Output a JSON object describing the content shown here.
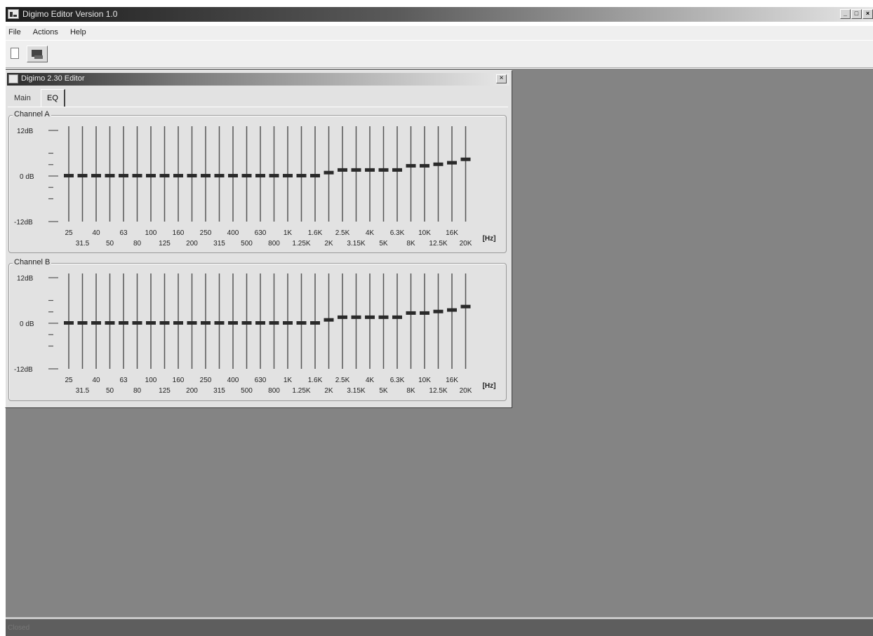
{
  "app": {
    "title": "Digimo Editor  Version 1.0",
    "window_buttons": [
      "_",
      "□",
      "×"
    ]
  },
  "menu": [
    {
      "label": "File"
    },
    {
      "label": "Actions"
    },
    {
      "label": "Help"
    }
  ],
  "toolbar": {
    "buttons": [
      {
        "icon": "new-document-icon"
      },
      {
        "icon": "connect-device-icon"
      }
    ]
  },
  "child_window": {
    "title": "Digimo 2.30 Editor",
    "close": "×"
  },
  "tabs": [
    {
      "label": "Main",
      "active": false
    },
    {
      "label": "EQ",
      "active": true
    }
  ],
  "eq": {
    "db_labels": {
      "top": "12dB",
      "mid": "0 dB",
      "bottom": "-12dB"
    },
    "unit": "[Hz]",
    "upper_freqs": [
      "25",
      "40",
      "63",
      "100",
      "160",
      "250",
      "400",
      "630",
      "1K",
      "1.6K",
      "2.5K",
      "4K",
      "6.3K",
      "10K",
      "16K"
    ],
    "lower_freqs": [
      "31.5",
      "50",
      "80",
      "125",
      "200",
      "315",
      "500",
      "800",
      "1.25K",
      "2K",
      "3.15K",
      "5K",
      "8K",
      "12.5K",
      "20K"
    ],
    "range_db": [
      -12,
      12
    ],
    "channels": [
      {
        "name": "Channel A",
        "gains_db": [
          0,
          0,
          0,
          0,
          0,
          0,
          0,
          0,
          0,
          0,
          0,
          0,
          0,
          0,
          0,
          0,
          0,
          0,
          0,
          0.8,
          1.5,
          1.5,
          1.5,
          1.5,
          1.5,
          2.6,
          2.6,
          3.0,
          3.4,
          4.3
        ]
      },
      {
        "name": "Channel B",
        "gains_db": [
          0,
          0,
          0,
          0,
          0,
          0,
          0,
          0,
          0,
          0,
          0,
          0,
          0,
          0,
          0,
          0,
          0,
          0,
          0,
          0.8,
          1.5,
          1.5,
          1.5,
          1.5,
          1.5,
          2.6,
          2.6,
          3.0,
          3.4,
          4.3
        ]
      }
    ]
  },
  "status": {
    "text": "Closed"
  }
}
